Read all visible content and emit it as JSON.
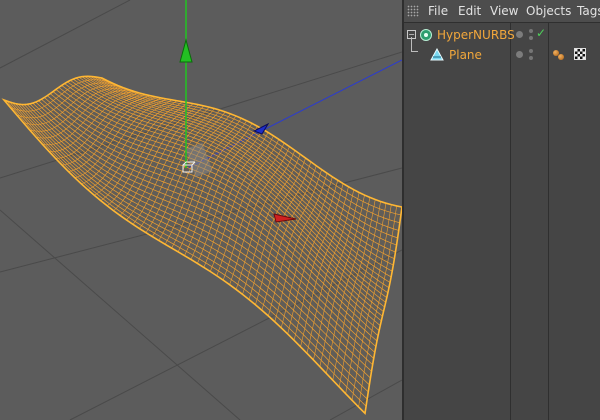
{
  "menu": {
    "file": "File",
    "edit": "Edit",
    "view": "View",
    "objects": "Objects",
    "tags": "Tags"
  },
  "objects": [
    {
      "name": "HyperNURBS",
      "icon": "hypernurbs-icon",
      "enabled_check": "✓"
    },
    {
      "name": "Plane",
      "icon": "plane-primitive-icon"
    }
  ],
  "colors": {
    "viewport_bg": "#5c5c5c",
    "wireframe": "#f0a030",
    "object_name": "#f2a73b",
    "axis_y": "#22c322",
    "axis_z": "#2233cc",
    "axis_x": "#cc2222"
  }
}
